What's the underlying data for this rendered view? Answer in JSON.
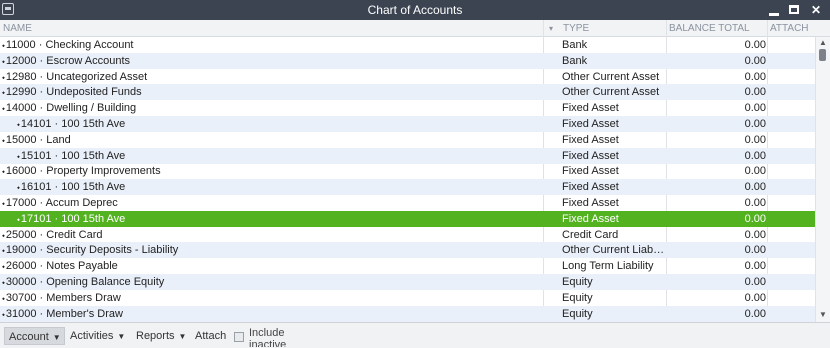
{
  "window": {
    "title": "Chart of Accounts"
  },
  "columns": {
    "name": "NAME",
    "type": "TYPE",
    "balance": "BALANCE TOTAL",
    "attach": "ATTACH",
    "sort_glyph": "▾"
  },
  "accounts": [
    {
      "name": "11000 · Checking Account",
      "type": "Bank",
      "balance": "0.00",
      "level": 0
    },
    {
      "name": "12000 · Escrow Accounts",
      "type": "Bank",
      "balance": "0.00",
      "level": 0
    },
    {
      "name": "12980 · Uncategorized Asset",
      "type": "Other Current Asset",
      "balance": "0.00",
      "level": 0
    },
    {
      "name": "12990 · Undeposited Funds",
      "type": "Other Current Asset",
      "balance": "0.00",
      "level": 0
    },
    {
      "name": "14000 · Dwelling / Building",
      "type": "Fixed Asset",
      "balance": "0.00",
      "level": 0
    },
    {
      "name": "14101 · 100 15th Ave",
      "type": "Fixed Asset",
      "balance": "0.00",
      "level": 1
    },
    {
      "name": "15000 · Land",
      "type": "Fixed Asset",
      "balance": "0.00",
      "level": 0
    },
    {
      "name": "15101 · 100 15th Ave",
      "type": "Fixed Asset",
      "balance": "0.00",
      "level": 1
    },
    {
      "name": "16000 · Property Improvements",
      "type": "Fixed Asset",
      "balance": "0.00",
      "level": 0
    },
    {
      "name": "16101 · 100 15th Ave",
      "type": "Fixed Asset",
      "balance": "0.00",
      "level": 1
    },
    {
      "name": "17000 · Accum Deprec",
      "type": "Fixed Asset",
      "balance": "0.00",
      "level": 0
    },
    {
      "name": "17101 · 100 15th Ave",
      "type": "Fixed Asset",
      "balance": "0.00",
      "level": 1,
      "selected": true
    },
    {
      "name": "25000 · Credit Card",
      "type": "Credit Card",
      "balance": "0.00",
      "level": 0
    },
    {
      "name": "19000 · Security Deposits - Liability",
      "type": "Other Current Liabil...",
      "balance": "0.00",
      "level": 0
    },
    {
      "name": "26000 · Notes Payable",
      "type": "Long Term Liability",
      "balance": "0.00",
      "level": 0
    },
    {
      "name": "30000 · Opening Balance Equity",
      "type": "Equity",
      "balance": "0.00",
      "level": 0
    },
    {
      "name": "30700 · Members Draw",
      "type": "Equity",
      "balance": "0.00",
      "level": 0
    },
    {
      "name": "31000 · Member's Draw",
      "type": "Equity",
      "balance": "0.00",
      "level": 0
    }
  ],
  "toolbar": {
    "account": "Account",
    "activities": "Activities",
    "reports": "Reports",
    "attach": "Attach",
    "include_inactive": "Include inactive",
    "dropdown_glyph": "▼"
  },
  "icons": {
    "row_marker": "⬩",
    "scroll_up": "▲",
    "scroll_down": "▼",
    "close": "✕"
  },
  "colors": {
    "titlebar": "#3c4452",
    "selected_row": "#53b21f",
    "alt_row": "#e9f0fa"
  }
}
